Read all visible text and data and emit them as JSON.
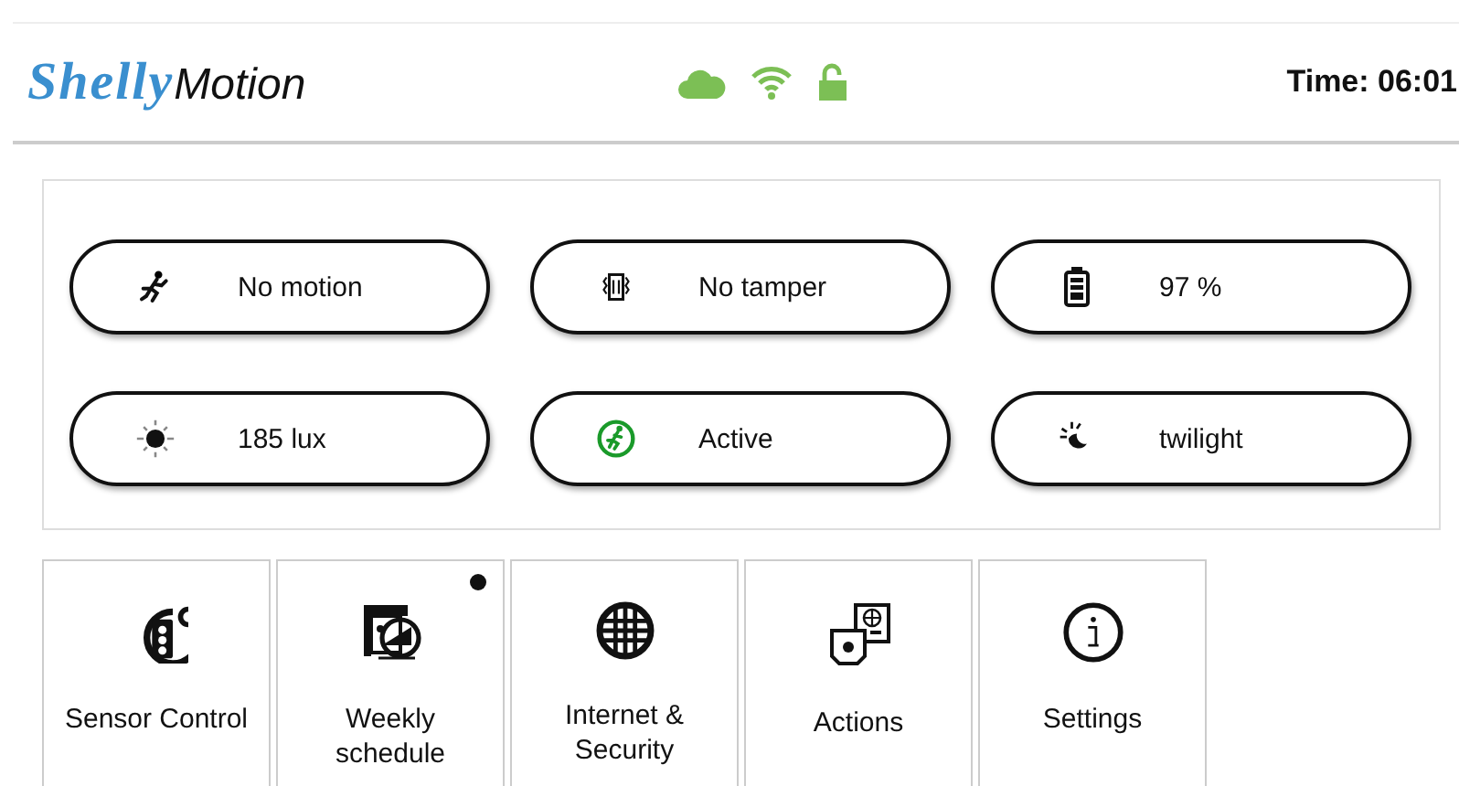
{
  "header": {
    "brand": "Shelly",
    "product": "Motion",
    "time": "Time: 06:01"
  },
  "status_pills": [
    {
      "kind": "motion",
      "label": "No motion"
    },
    {
      "kind": "tamper",
      "label": "No tamper"
    },
    {
      "kind": "battery",
      "label": "97 %"
    },
    {
      "kind": "lux",
      "label": "185 lux"
    },
    {
      "kind": "active",
      "label": "Active"
    },
    {
      "kind": "twilight",
      "label": "twilight"
    }
  ],
  "tiles": [
    {
      "kind": "sensor",
      "label": "Sensor Control",
      "badge": false
    },
    {
      "kind": "schedule",
      "label": "Weekly schedule",
      "badge": true
    },
    {
      "kind": "internet",
      "label": "Internet & Security",
      "badge": false
    },
    {
      "kind": "actions",
      "label": "Actions",
      "badge": false
    },
    {
      "kind": "settings",
      "label": "Settings",
      "badge": false
    }
  ]
}
